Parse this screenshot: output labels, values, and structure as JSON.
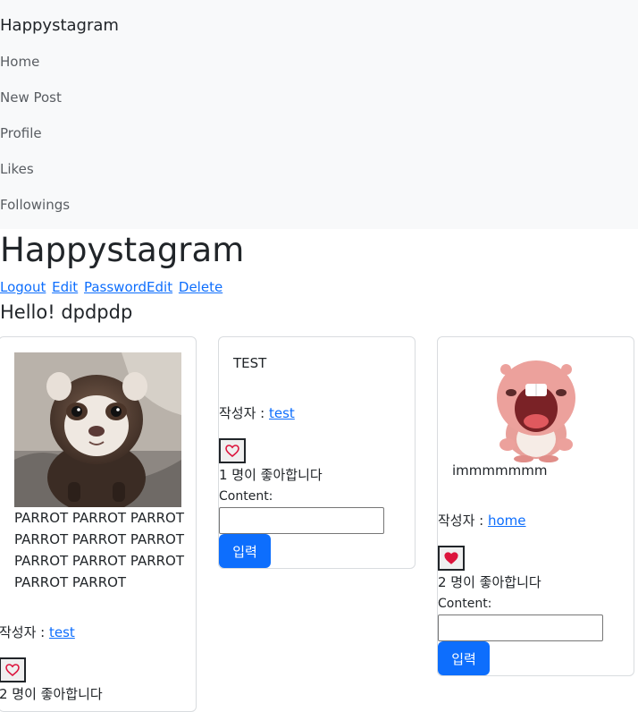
{
  "navbar": {
    "brand": "Happystagram",
    "links": [
      "Home",
      "New Post",
      "Profile",
      "Likes",
      "Followings"
    ]
  },
  "header": {
    "title": "Happystagram",
    "account_links": [
      "Logout",
      "Edit",
      "PasswordEdit",
      "Delete"
    ],
    "greeting": "Hello! dpdpdp"
  },
  "posts": [
    {
      "image": "ferret-photo",
      "content": "PARROT PARROT PARROT PARROT PARROT PARROT PARROT PARROT PARROT PARROT PARROT",
      "author_label": "작성자 : ",
      "author": "test",
      "liked": false,
      "like_count_text": "2 명이 좋아합니다"
    },
    {
      "image": "",
      "content": "TEST",
      "author_label": "작성자 : ",
      "author": "test",
      "liked": false,
      "like_count_text": "1 명이 좋아합니다",
      "comment_label": "Content:",
      "comment_value": "",
      "submit_label": "입력"
    },
    {
      "image": "pink-beaver-character",
      "content": "immmmmmm",
      "author_label": "작성자 : ",
      "author": "home",
      "liked": true,
      "like_count_text": "2 명이 좋아합니다",
      "comment_label": "Content:",
      "comment_value": "",
      "submit_label": "입력"
    }
  ],
  "colors": {
    "navbar_bg": "#f8f9fa",
    "link": "#0d6efd",
    "primary_button": "#0d6efd",
    "heart": "#dc143c"
  },
  "icons": {
    "heart_outline": "heart-outline-icon",
    "heart_filled": "heart-filled-icon"
  }
}
